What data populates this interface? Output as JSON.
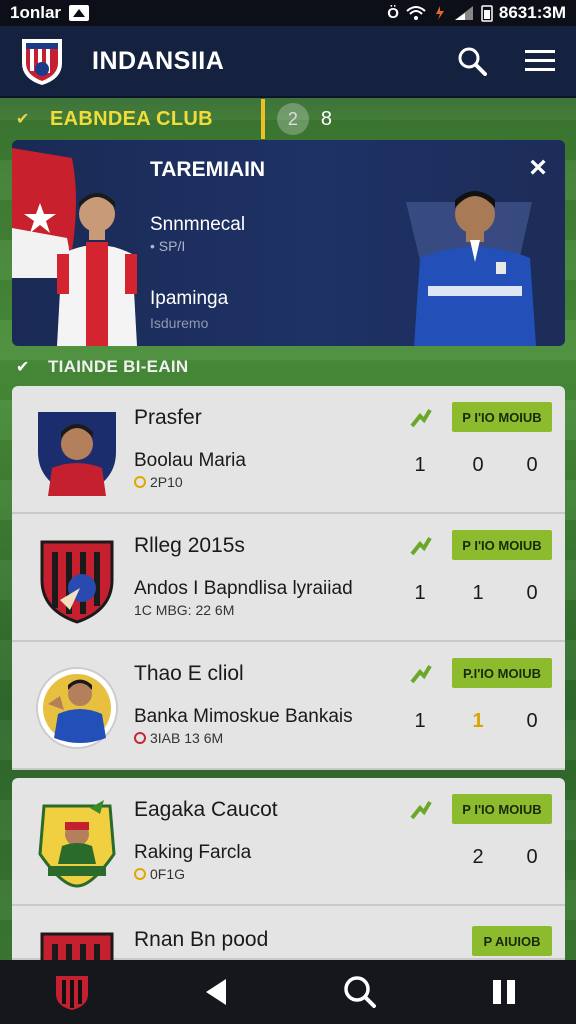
{
  "status_bar": {
    "left_text": "1onlar",
    "time": "8631:3M"
  },
  "app_bar": {
    "title": "INDANSIIA"
  },
  "club_row": {
    "label": "EABNDEA CLUB",
    "count_badge": "2",
    "count": "8"
  },
  "feature": {
    "title": "TAREMIAIN",
    "line1": "Snnmnecal",
    "line1_meta": "• SP/I",
    "line2": "Ipaminga",
    "line2_meta": "Isduremo"
  },
  "section2": {
    "label": "TIAINDE BI-EAIN"
  },
  "matches": [
    {
      "title": "Prasfer",
      "subtitle": "Boolau Maria",
      "meta": "2P10",
      "badge": "P I'IO MOIUB",
      "scores": [
        "1",
        "0",
        "0"
      ],
      "highlight": null
    },
    {
      "title": "Rlleg 2015s",
      "subtitle": "Andos I Bapndlisa lyraiiad",
      "meta": "1C MBG: 22 6M",
      "badge": "P I'IO MOIUB",
      "scores": [
        "1",
        "1",
        "0"
      ],
      "highlight": null
    },
    {
      "title": "Thao E cliol",
      "subtitle": "Banka Mimoskue Bankais",
      "meta": "3IAB 13 6M",
      "badge": "P.I'IO MOIUB",
      "scores": [
        "1",
        "1",
        "0"
      ],
      "highlight": 1
    },
    {
      "title": "Eagaka Caucot",
      "subtitle": "Raking Farcla",
      "meta": "0F1G",
      "badge": "P I'IO MOIUB",
      "scores": [
        "",
        "2",
        "0"
      ],
      "highlight": null
    },
    {
      "title": "Rnan Bn pood",
      "subtitle": "",
      "meta": "",
      "badge": "P AIUIOB",
      "scores": [
        "",
        "",
        ""
      ],
      "highlight": null
    }
  ],
  "colors": {
    "app_bar": "#14213f",
    "accent_yellow": "#f2dc3a",
    "badge_green": "#8dbb2e",
    "card_bg": "#e4e4e4"
  },
  "icons": [
    "club-crest-icon",
    "search-icon",
    "menu-icon",
    "close-icon",
    "trend-icon",
    "back-icon",
    "nav-search-icon",
    "pause-icon"
  ]
}
